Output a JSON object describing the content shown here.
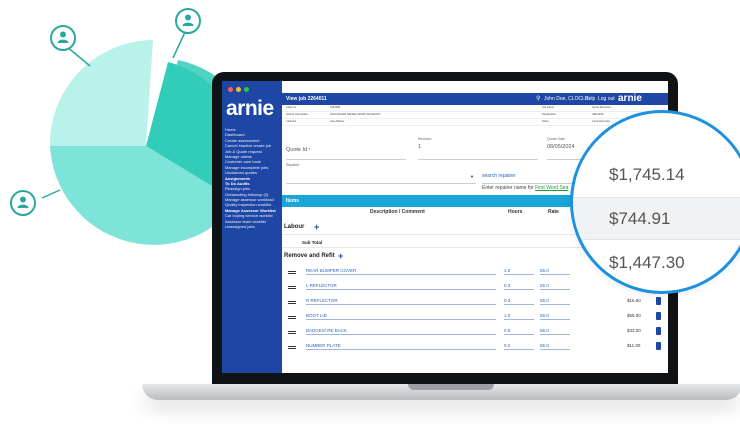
{
  "app": {
    "brand": "arnie",
    "logo_small": "arnie",
    "page_title": "View job 2264011"
  },
  "topbar": {
    "search_icon": "search-icon",
    "user": "John Doe, CLOCLS",
    "help": "Help",
    "logout": "Log out"
  },
  "sidebar": {
    "items": [
      "Home",
      "Dashboard",
      "Create assessment",
      "Cancel Inactive create job",
      "Job & Quote request",
      "Manage claims",
      "Customer care tools",
      "Manage incomplete jobs",
      "Unclaimed quotes",
      "Assignments",
      "To Do Audits",
      "Reassign jobs",
      "Outstanding followup (3)",
      "Manage assessor workload",
      "Quality inspection worklist",
      "Manage Assessor Worklist",
      "Car buying service worklist",
      "Assessor team worklist",
      "Unassigned jobs"
    ],
    "bold_items": [
      "Assignments",
      "To Do Audits",
      "Manage Assessor Worklist"
    ]
  },
  "info_grid": [
    [
      "Claim no.",
      "1951098",
      "Job status",
      "Quote Received"
    ],
    [
      "Vehicle Description",
      "2015 NISSAN NAVARA NP300 4D WAGON",
      "Registration",
      "ABC123D"
    ],
    [
      "Claimant",
      "Jane Barlow",
      "Policy",
      "Comprehensive"
    ]
  ],
  "form": {
    "quote_id_label": "Quote Id",
    "revision_label": "Revision",
    "revision_value": "1",
    "quote_date_label": "Quote Date",
    "quote_date_value": "08/05/2024",
    "repairer_label": "Repairer",
    "search_repairer": "search repairer",
    "hint_prefix": "Enter repairer name for",
    "hint_link": "First Word Sea"
  },
  "items": {
    "header": "Items",
    "col_desc": "Description / Comment",
    "col_hours": "Hours",
    "col_rate": "Rate",
    "labour_label": "Labour",
    "subtotal_label": "Sub Total",
    "remove_refit_label": "Remove and Refit",
    "rows": [
      {
        "desc": "REAR BUMPER COVER",
        "hours": "1.0",
        "rate": "55.0",
        "amount": ""
      },
      {
        "desc": "L REFLECTOR",
        "hours": "0.3",
        "rate": "55.0",
        "amount": ""
      },
      {
        "desc": "R REFLECTOR",
        "hours": "0.3",
        "rate": "55.0",
        "amount": "$16.50"
      },
      {
        "desc": "BOOT LID",
        "hours": "1.0",
        "rate": "55.0",
        "amount": "$55.00"
      },
      {
        "desc": "BADGES/ RE BACK",
        "hours": "0.6",
        "rate": "55.0",
        "amount": "$33.00"
      },
      {
        "desc": "NUMBER PLATE",
        "hours": "0.2",
        "rate": "55.0",
        "amount": "$11.00"
      }
    ]
  },
  "magnifier": {
    "values": [
      "$1,745.14",
      "$744.91",
      "$1,447.30"
    ]
  },
  "pie_chart": {
    "type": "pie",
    "slices": [
      {
        "value": 36,
        "color": "#32cdb8"
      },
      {
        "value": 24,
        "color": "#7ee3d8"
      },
      {
        "value": 34,
        "color": "#b9f2eb"
      },
      {
        "value": 6,
        "color": "#ffffff"
      }
    ],
    "markers": [
      "user-icon",
      "user-icon",
      "user-icon",
      "user-icon"
    ]
  },
  "colors": {
    "sidebar": "#1e46a4",
    "items_header": "#1aa6d9",
    "accent": "#1e90e0",
    "pie_dark": "#32cdb8"
  }
}
